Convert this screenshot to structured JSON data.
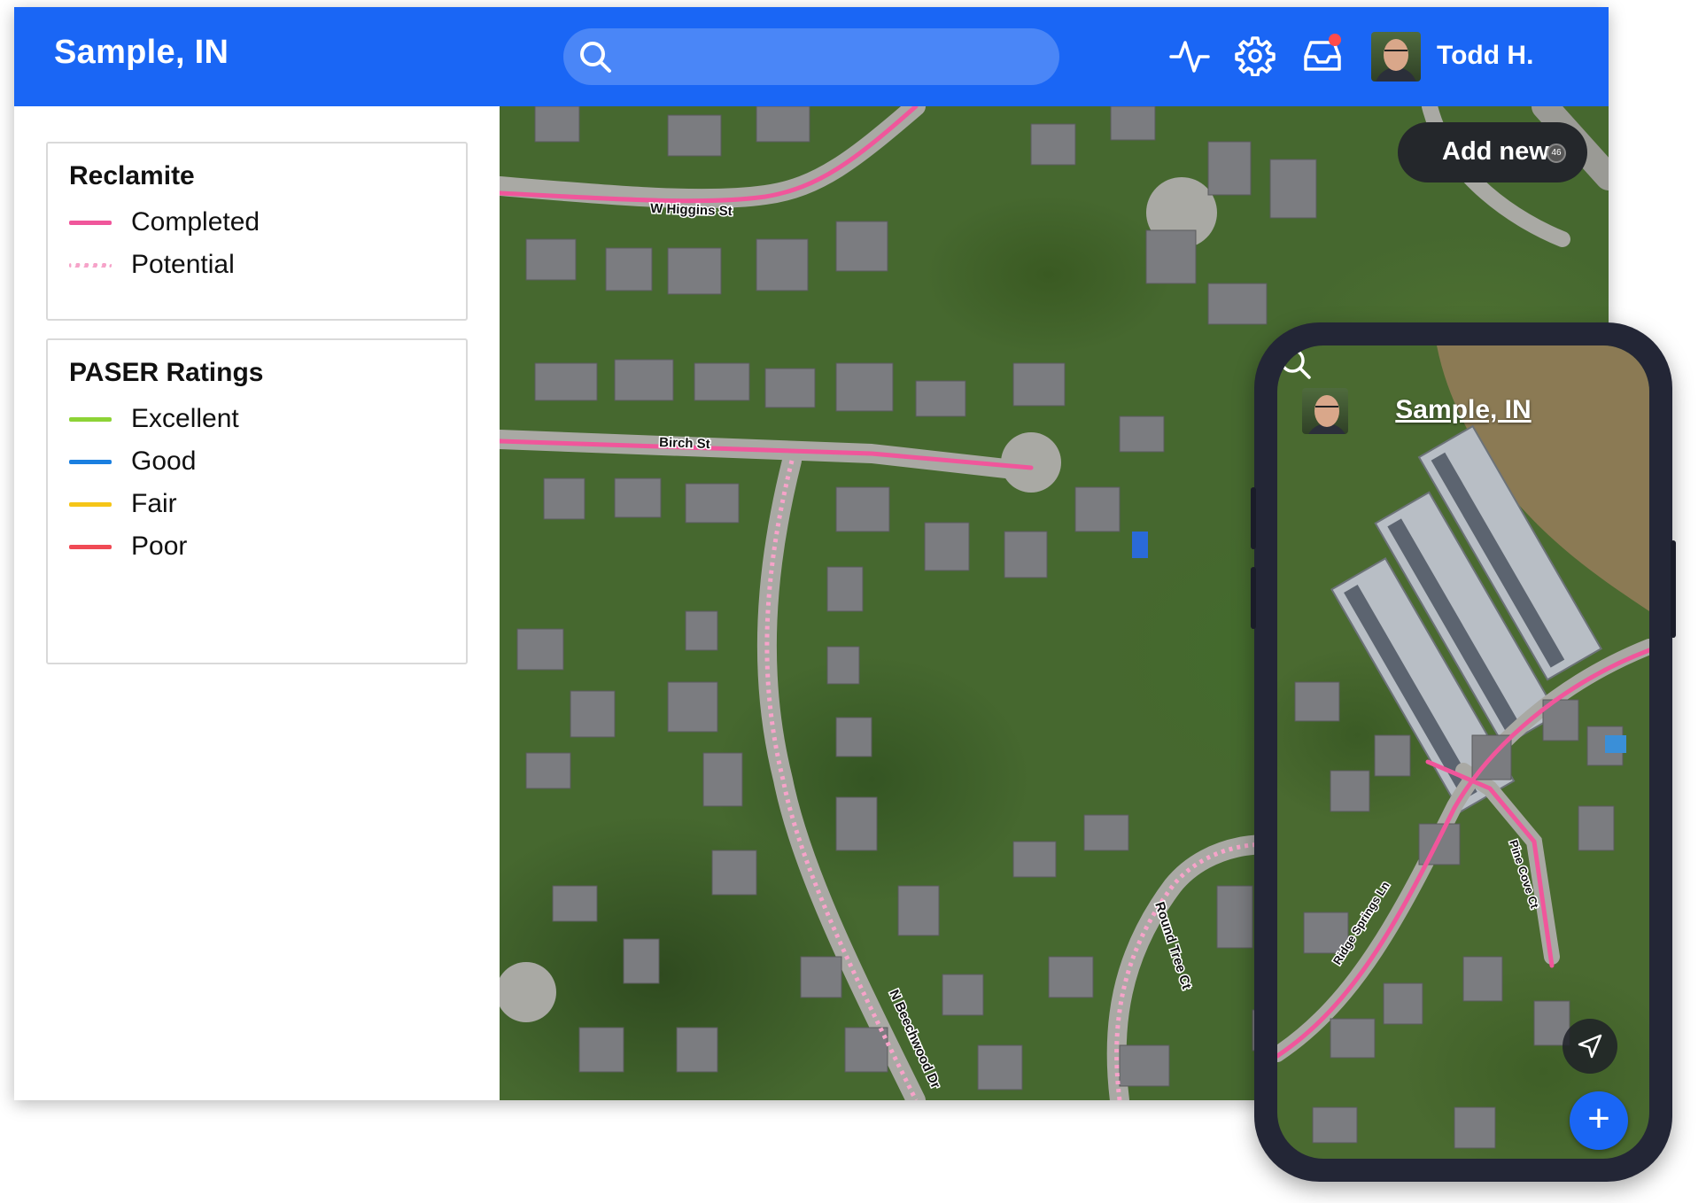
{
  "app": {
    "title": "Sample, IN",
    "search_placeholder": "",
    "user_name": "Todd H."
  },
  "header_icons": [
    "activity-icon",
    "settings-icon",
    "inbox-icon"
  ],
  "legends": [
    {
      "title": "Reclamite",
      "items": [
        {
          "label": "Completed",
          "color": "#f0569b",
          "style": "solid"
        },
        {
          "label": "Potential",
          "color": "#f6a3c9",
          "style": "dotted"
        }
      ]
    },
    {
      "title": "PASER Ratings",
      "items": [
        {
          "label": "Excellent",
          "color": "#8dd336",
          "style": "solid"
        },
        {
          "label": "Good",
          "color": "#1a7fe0",
          "style": "solid"
        },
        {
          "label": "Fair",
          "color": "#f5c518",
          "style": "solid"
        },
        {
          "label": "Poor",
          "color": "#f04a55",
          "style": "solid"
        }
      ]
    }
  ],
  "map": {
    "add_new_label": "Add new",
    "add_new_badge": "46",
    "street_labels": [
      "W Higgins St",
      "Birch St",
      "N Beechwood Dr",
      "Round Tree Ct"
    ]
  },
  "phone": {
    "title": "Sample, IN",
    "fab_label": "+",
    "street_labels": [
      "Ridge Springs Ln",
      "Pine Cove Ct"
    ]
  },
  "colors": {
    "brand": "#1a66f5",
    "road_completed": "#f0569b",
    "road_potential": "#f6a3c9"
  }
}
